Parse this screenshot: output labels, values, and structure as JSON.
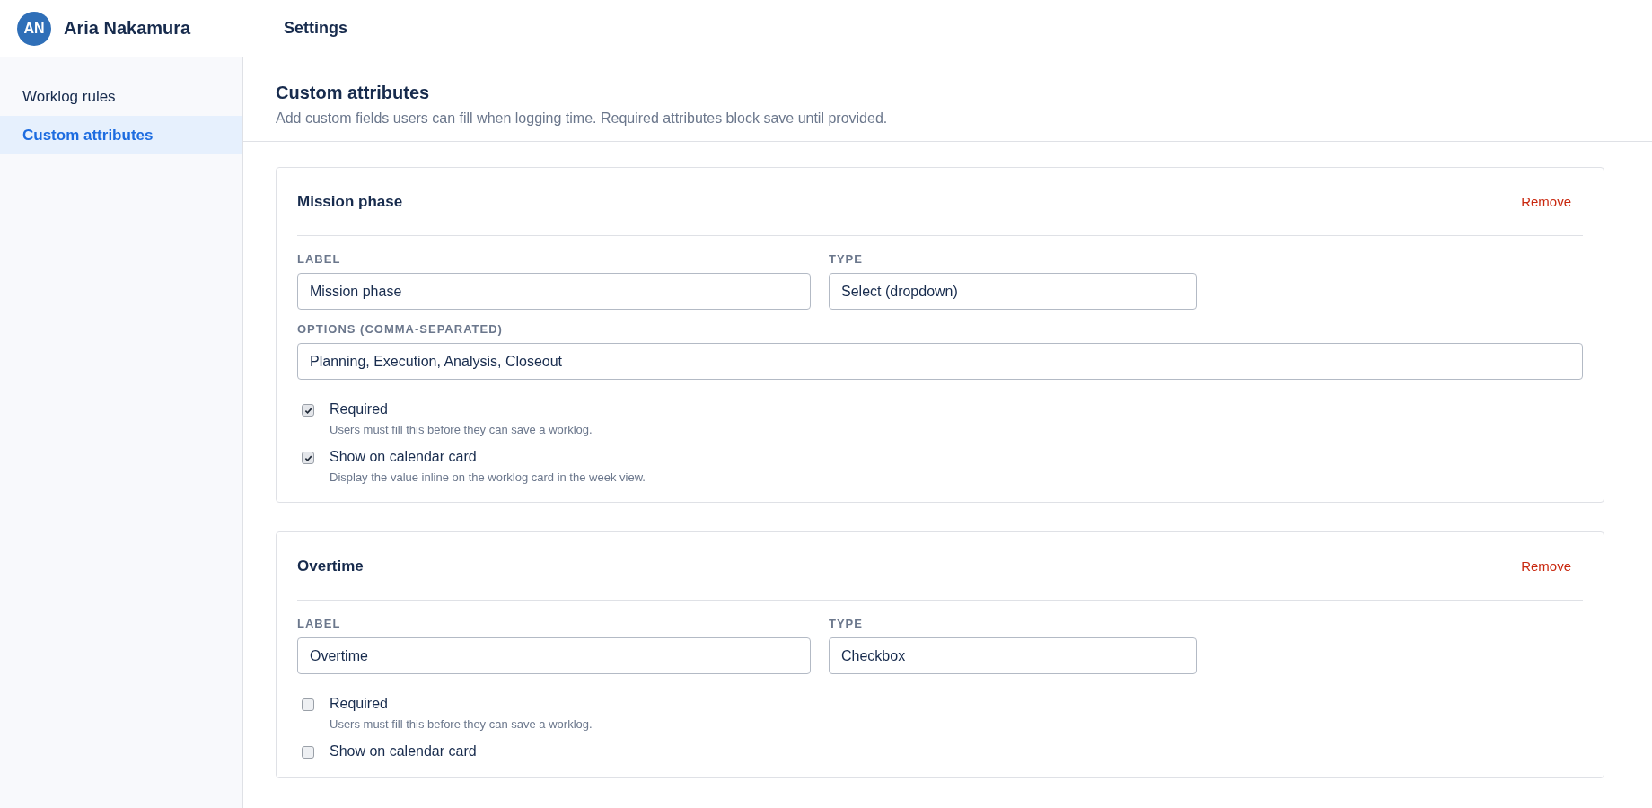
{
  "header": {
    "avatar_initials": "AN",
    "user_name": "Aria Nakamura",
    "title": "Settings"
  },
  "sidebar": {
    "items": [
      {
        "label": "Worklog rules",
        "selected": false
      },
      {
        "label": "Custom attributes",
        "selected": true
      }
    ]
  },
  "page": {
    "title": "Custom attributes",
    "description": "Add custom fields users can fill when logging time. Required attributes block save until provided."
  },
  "attributes": [
    {
      "name": "Mission phase",
      "remove_label": "Remove",
      "label_caption": "LABEL",
      "label_value": "Mission phase",
      "type_caption": "TYPE",
      "type_value": "Select (dropdown)",
      "options_caption": "OPTIONS (COMMA-SEPARATED)",
      "options_value": "Planning, Execution, Analysis, Closeout",
      "checks": [
        {
          "label": "Required",
          "hint": "Users must fill this before they can save a worklog.",
          "checked": true
        },
        {
          "label": "Show on calendar card",
          "hint": "Display the value inline on the worklog card in the week view.",
          "checked": true
        }
      ]
    },
    {
      "name": "Overtime",
      "remove_label": "Remove",
      "label_caption": "LABEL",
      "label_value": "Overtime",
      "type_caption": "TYPE",
      "type_value": "Checkbox",
      "checks": [
        {
          "label": "Required",
          "hint": "Users must fill this before they can save a worklog.",
          "checked": false
        },
        {
          "label": "Show on calendar card",
          "checked": false
        }
      ]
    }
  ]
}
